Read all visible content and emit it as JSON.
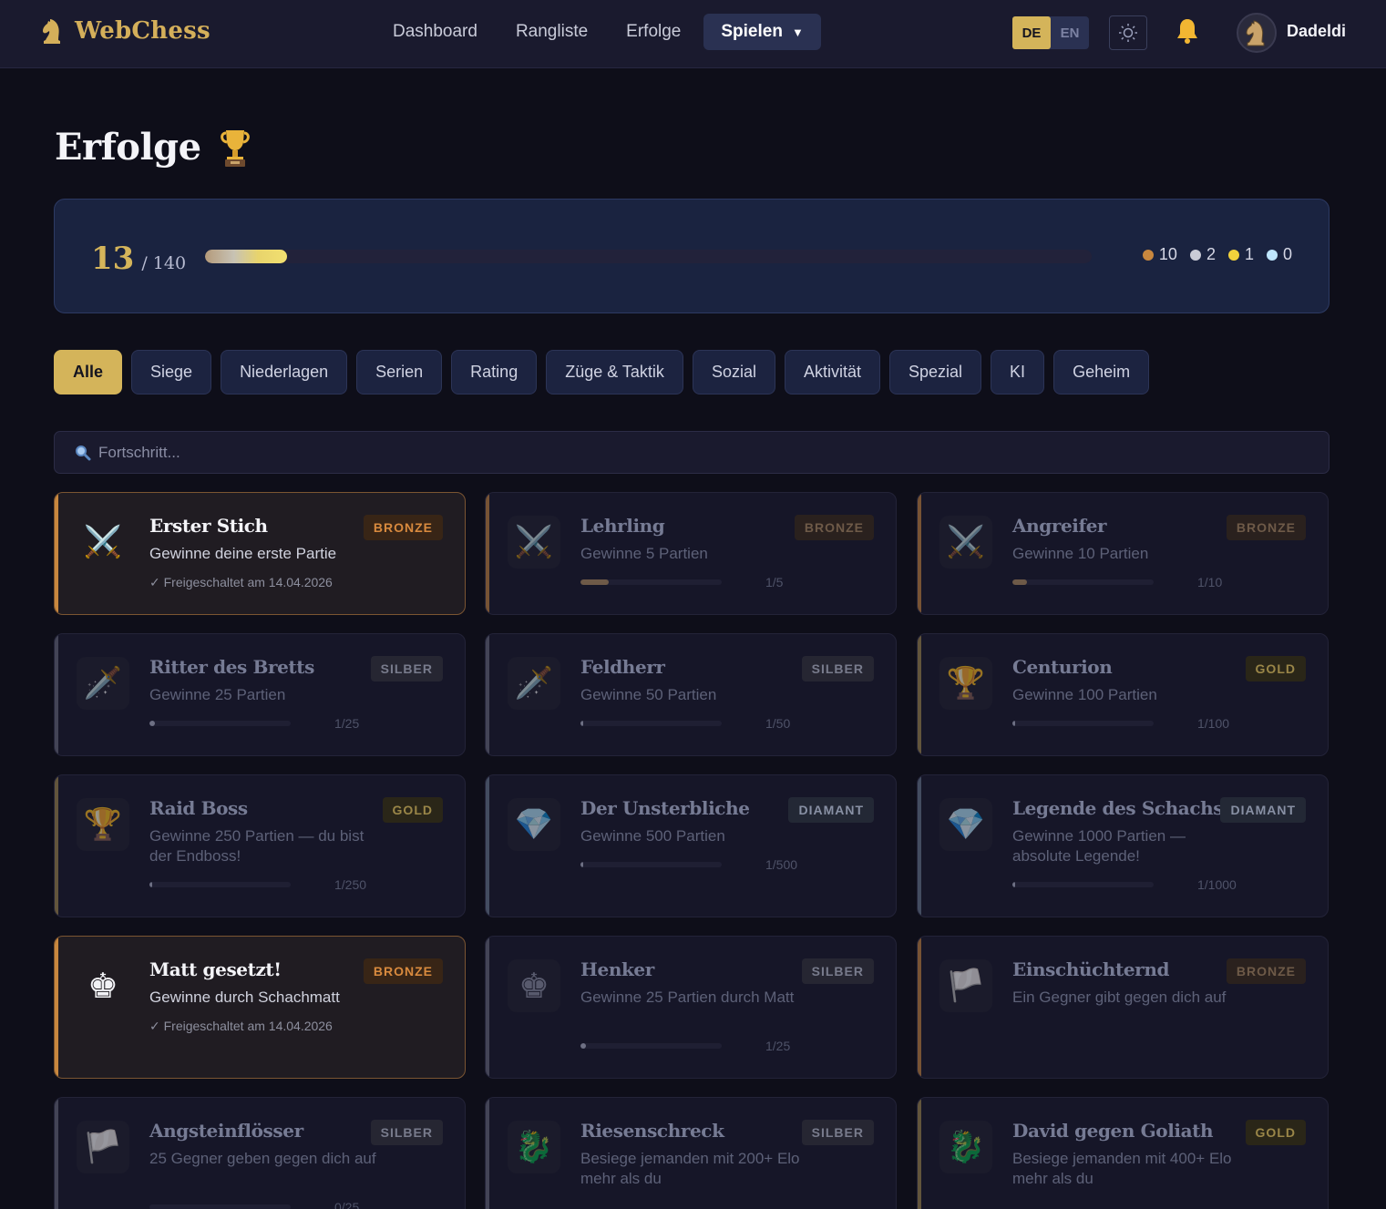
{
  "app": {
    "name": "WebChess"
  },
  "nav": {
    "links": [
      "Dashboard",
      "Rangliste",
      "Erfolge"
    ],
    "play_label": "Spielen",
    "play_caret": "▼"
  },
  "lang": {
    "active": "DE",
    "inactive": "EN"
  },
  "user": {
    "name": "Dadeldi"
  },
  "page": {
    "title": "Erfolge"
  },
  "summary": {
    "unlocked": "13",
    "total_label": "/ 140",
    "progress_percent": 9.3,
    "tiers": [
      {
        "count": "10",
        "color": "#c8873e"
      },
      {
        "count": "2",
        "color": "#c9cbd6"
      },
      {
        "count": "1",
        "color": "#f2d23c"
      },
      {
        "count": "0",
        "color": "#bfe6ff"
      }
    ]
  },
  "filters": [
    "Alle",
    "Siege",
    "Niederlagen",
    "Serien",
    "Rating",
    "Züge & Taktik",
    "Sozial",
    "Aktivität",
    "Spezial",
    "KI",
    "Geheim"
  ],
  "search": {
    "placeholder": "Fortschritt..."
  },
  "tier_colors": {
    "BRONZE": "#c8873e",
    "SILBER": "#6a6c7c",
    "GOLD": "#a28a4c",
    "DIAMANT": "#6a7a8e"
  },
  "achievements": [
    {
      "title": "Erster Stich",
      "desc": "Gewinne deine erste Partie",
      "tier": "BRONZE",
      "icon": "⚔️",
      "unlocked": true,
      "note": "✓ Freigeschaltet am 14.04.2026"
    },
    {
      "title": "Lehrling",
      "desc": "Gewinne 5 Partien",
      "tier": "BRONZE",
      "icon": "⚔️",
      "unlocked": false,
      "progress": "1/5",
      "fraction": 0.2
    },
    {
      "title": "Angreifer",
      "desc": "Gewinne 10 Partien",
      "tier": "BRONZE",
      "icon": "⚔️",
      "unlocked": false,
      "progress": "1/10",
      "fraction": 0.1
    },
    {
      "title": "Ritter des Bretts",
      "desc": "Gewinne 25 Partien",
      "tier": "SILBER",
      "icon": "🗡️",
      "unlocked": false,
      "progress": "1/25",
      "fraction": 0.04
    },
    {
      "title": "Feldherr",
      "desc": "Gewinne 50 Partien",
      "tier": "SILBER",
      "icon": "🗡️",
      "unlocked": false,
      "progress": "1/50",
      "fraction": 0.02
    },
    {
      "title": "Centurion",
      "desc": "Gewinne 100 Partien",
      "tier": "GOLD",
      "icon": "🏆",
      "unlocked": false,
      "progress": "1/100",
      "fraction": 0.01
    },
    {
      "title": "Raid Boss",
      "desc": "Gewinne 250 Partien — du bist der Endboss!",
      "tier": "GOLD",
      "icon": "🏆",
      "unlocked": false,
      "progress": "1/250",
      "fraction": 0.004
    },
    {
      "title": "Der Unsterbliche",
      "desc": "Gewinne 500 Partien",
      "tier": "DIAMANT",
      "icon": "💎",
      "unlocked": false,
      "progress": "1/500",
      "fraction": 0.002
    },
    {
      "title": "Legende des Schachs",
      "desc": "Gewinne 1000 Partien — absolute Legende!",
      "tier": "DIAMANT",
      "icon": "💎",
      "unlocked": false,
      "progress": "1/1000",
      "fraction": 0.001
    },
    {
      "title": "Matt gesetzt!",
      "desc": "Gewinne durch Schachmatt",
      "tier": "BRONZE",
      "icon": "♚",
      "unlocked": true,
      "note": "✓ Freigeschaltet am 14.04.2026"
    },
    {
      "title": "Henker",
      "desc": "Gewinne 25 Partien durch Matt",
      "tier": "SILBER",
      "icon": "♚",
      "unlocked": false,
      "progress": "1/25",
      "fraction": 0.04
    },
    {
      "title": "Einschüchternd",
      "desc": "Ein Gegner gibt gegen dich auf",
      "tier": "BRONZE",
      "icon": "🏳️",
      "unlocked": false
    },
    {
      "title": "Angsteinflösser",
      "desc": "25 Gegner geben gegen dich auf",
      "tier": "SILBER",
      "icon": "🏳️",
      "unlocked": false,
      "progress": "0/25",
      "fraction": 0
    },
    {
      "title": "Riesenschreck",
      "desc": "Besiege jemanden mit 200+ Elo mehr als du",
      "tier": "SILBER",
      "icon": "🐉",
      "unlocked": false
    },
    {
      "title": "David gegen Goliath",
      "desc": "Besiege jemanden mit 400+ Elo mehr als du",
      "tier": "GOLD",
      "icon": "🐉",
      "unlocked": false
    }
  ]
}
